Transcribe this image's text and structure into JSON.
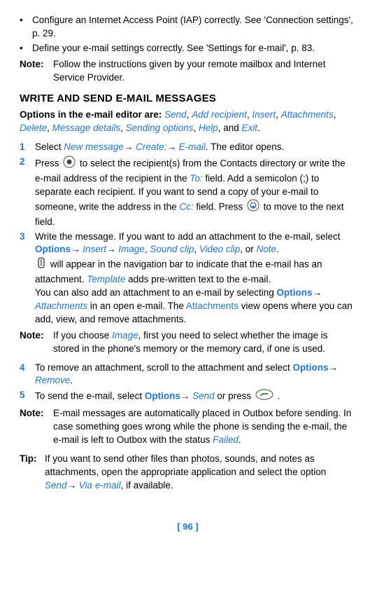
{
  "bullets": [
    "Configure an Internet Access Point (IAP) correctly. See 'Connection settings', p. 29.",
    "Define your e-mail settings correctly. See 'Settings for e-mail', p. 83."
  ],
  "note1": {
    "label": "Note:",
    "text": "Follow the instructions given by your remote mailbox and Internet Service Provider."
  },
  "heading": "WRITE AND SEND E-MAIL MESSAGES",
  "optionsIntro": "Options in the e-mail editor are: ",
  "optionsList": {
    "o1": "Send",
    "o2": "Add recipient",
    "o3": "Insert",
    "o4": "Attachments",
    "o5": "Delete",
    "o6": "Message details",
    "o7": "Sending options",
    "o8": "Help",
    "o9": "Exit"
  },
  "step1": {
    "num": "1",
    "pre": "Select ",
    "a": "New message",
    "b": "Create:",
    "c": "E-mail",
    "post": ". The editor opens."
  },
  "step2": {
    "num": "2",
    "t1": "Press ",
    "t2": " to select the recipient(s) from the Contacts directory or write the e-mail address of the recipient in the ",
    "to": "To:",
    "t3": " field. Add a semicolon (;) to separate each recipient.  If you want to send a copy of your e-mail to someone, write the address in the ",
    "cc": "Cc:",
    "t4": " field. Press ",
    "t5": " to move to the next field."
  },
  "step3": {
    "num": "3",
    "t1": "Write the message. If you want to add an attachment to the e-mail, select ",
    "options": "Options",
    "insert": "Insert",
    "image": "Image",
    "sound": "Sound clip",
    "video": "Video clip",
    "note": "Note",
    "t2": " will appear in the navigation bar to indicate that the e-mail has an attachment. ",
    "template": "Template",
    "t3": " adds pre-written text to the e-mail.",
    "t4": "You can also add an attachment to an e-mail by selecting ",
    "options2": "Options",
    "attachments": "Attachments",
    "t5": " in an open e-mail. The ",
    "attachments2": "Attachments",
    "t6": " view opens where you can add, view, and remove attachments."
  },
  "note2": {
    "label": "Note:",
    "t1": "If you choose ",
    "image": "Image",
    "t2": ", first you need to select whether the image is stored in the phone's memory or the memory card, if one is used."
  },
  "step4": {
    "num": "4",
    "t1": "To remove an attachment, scroll to the attachment and select ",
    "options": "Options",
    "remove": "Remove"
  },
  "step5": {
    "num": "5",
    "t1": "To send the e-mail, select ",
    "options": "Options",
    "send": "Send",
    "t2": " or press ",
    "t3": " ."
  },
  "note3": {
    "label": "Note:",
    "t1": "E-mail messages are automatically placed in Outbox before sending. In case something goes wrong while the phone is sending the e-mail, the e-mail is left to Outbox with the status ",
    "failed": "Failed"
  },
  "tip": {
    "label": "Tip:",
    "t1": "If you want to send other files than photos, sounds, and notes as attachments, open the appropriate application and select the option ",
    "send": "Send",
    "via": "Via e-mail",
    "t2": ", if available."
  },
  "pageNum": "[ 96 ]",
  "punct": {
    "comma": ", ",
    "and": ", and ",
    "period": ".",
    "or": ", or "
  }
}
